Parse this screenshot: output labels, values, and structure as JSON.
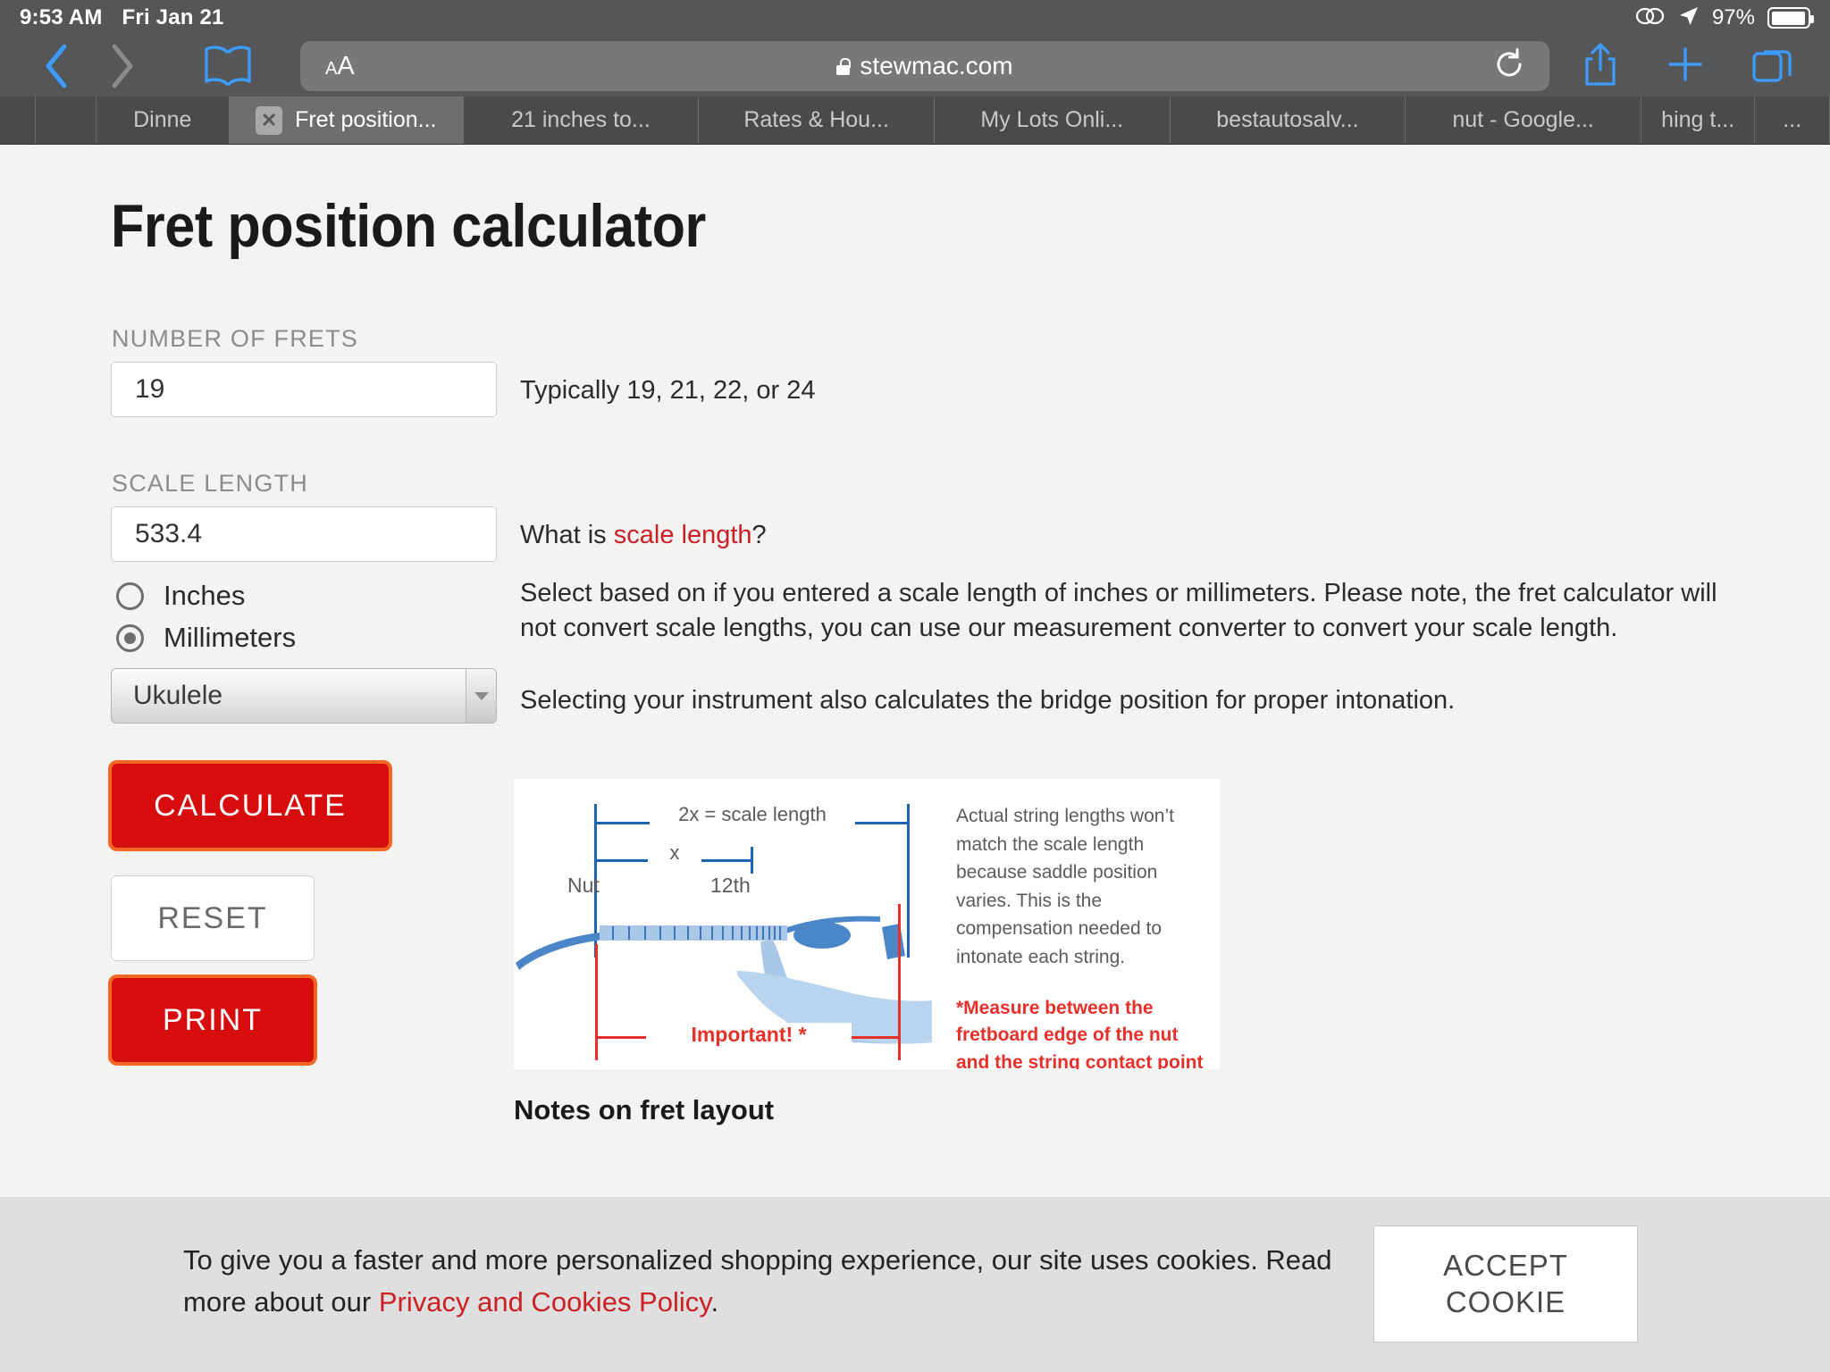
{
  "status_bar": {
    "time": "9:53 AM",
    "date": "Fri Jan 21",
    "battery_percent": "97%",
    "icons": [
      "screen-mirroring-icon",
      "location-arrow-icon",
      "battery-icon"
    ]
  },
  "browser": {
    "back_label": "back-icon",
    "forward_label": "forward-icon",
    "bookmarks_label": "book-icon",
    "text_size_small": "A",
    "text_size_large": "A",
    "url": "stewmac.com",
    "reload_label": "reload-icon",
    "share_label": "share-icon",
    "newtab_label": "plus-icon",
    "tabs_overview_label": "tabs-icon",
    "tabs": [
      {
        "label": "",
        "active": false
      },
      {
        "label": "",
        "active": false
      },
      {
        "label": "Dinne",
        "active": false
      },
      {
        "label": "Fret position...",
        "active": true,
        "close": "✕"
      },
      {
        "label": "21 inches to...",
        "active": false
      },
      {
        "label": "Rates & Hou...",
        "active": false
      },
      {
        "label": "My Lots Onli...",
        "active": false
      },
      {
        "label": "bestautosalv...",
        "active": false
      },
      {
        "label": "nut - Google...",
        "active": false
      },
      {
        "label": "hing t...",
        "active": false
      },
      {
        "label": "...",
        "active": false
      }
    ]
  },
  "page": {
    "title": "Fret position calculator",
    "fields": {
      "frets_label": "NUMBER OF FRETS",
      "frets_value": "19",
      "frets_help": "Typically 19, 21, 22, or 24",
      "scale_label": "SCALE LENGTH",
      "scale_value": "533.4",
      "scale_help_before": "What is ",
      "scale_help_link": "scale length",
      "scale_help_after": "?"
    },
    "units": {
      "inches_label": "Inches",
      "millimeters_label": "Millimeters",
      "selected": "Millimeters",
      "help": "Select based on if you entered a scale length of inches or millimeters. Please note, the fret calculator will not convert scale lengths, you can use our measurement converter to convert your scale length."
    },
    "instrument": {
      "selected": "Ukulele",
      "help": "Selecting your instrument also calculates the bridge position for proper intonation."
    },
    "buttons": {
      "calculate": "CALCULATE",
      "reset": "RESET",
      "print": "PRINT"
    },
    "diagram": {
      "scale_label": "2x = scale length",
      "x_label": "x",
      "nut_label": "Nut",
      "twelfth_label": "12th",
      "important_label": "Important! *",
      "note_right": "Actual string lengths won’t match the scale length because saddle position varies. This is the compensation needed to intonate each string.",
      "note_red": "*Measure between the fretboard edge of the nut  and the string contact point on the saddle."
    },
    "notes_heading": "Notes on fret layout"
  },
  "cookie_banner": {
    "text_before": "To give you a faster and more personalized shopping experience, our site uses cookies. Read more about our ",
    "link": "Privacy and Cookies Policy",
    "text_after": ".",
    "accept_line1": "ACCEPT",
    "accept_line2": "COOKIE"
  },
  "colors": {
    "chrome": "#555657",
    "tabstrip": "#4a4a4b",
    "page_bg": "#f3f3f2",
    "accent_red": "#d70d0d",
    "link_red": "#cc2025",
    "focus_orange": "#f26722",
    "diagram_blue": "#1c63b4",
    "diagram_red": "#e8302b",
    "cookie_bg": "#dfdfdf"
  }
}
